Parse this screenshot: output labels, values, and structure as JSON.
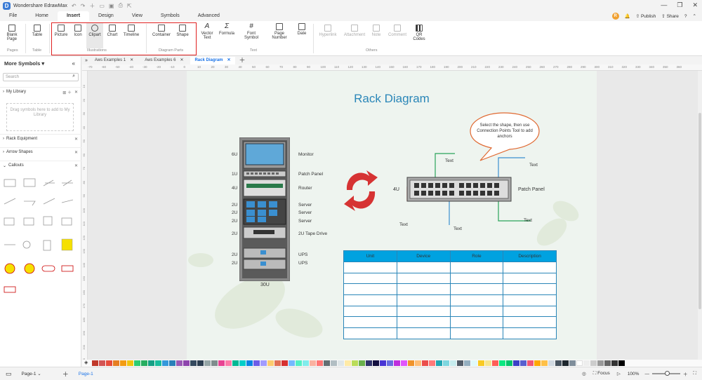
{
  "app": {
    "name": "Wondershare EdrawMax",
    "logo_letter": "D"
  },
  "user": {
    "initial": "R"
  },
  "window_controls": {
    "minimize": "—",
    "maximize": "❐",
    "close": "✕"
  },
  "menu": {
    "items": [
      "File",
      "Home",
      "Insert",
      "Design",
      "View",
      "Symbols",
      "Advanced"
    ],
    "active": "Insert",
    "publish": "Publish",
    "share": "Share",
    "help": "?"
  },
  "ribbon": {
    "blank_page": "Blank Page",
    "table": "Table",
    "picture": "Picture",
    "icon": "Icon",
    "clipart": "Clipart",
    "chart": "Chart",
    "timeline": "Timeline",
    "container": "Container",
    "shape": "Shape",
    "vector_text": "Vector Text",
    "formula": "Formula",
    "font_symbol": "Font Symbol",
    "page_number": "Page Number",
    "date": "Date",
    "hyperlink": "Hyperlink",
    "attachment": "Attachment",
    "note": "Note",
    "comment": "Comment",
    "qr_codes": "QR Codes",
    "groups": {
      "pages": "Pages",
      "table": "Table",
      "illustrations": "Illustrations",
      "diagram_parts": "Diagram Parts",
      "text": "Text",
      "others": "Others"
    }
  },
  "sidebar": {
    "title": "More Symbols",
    "search_placeholder": "Search",
    "my_library": "My Library",
    "drop_hint": "Drag symbols here to add to My Library",
    "sections": [
      "Rack Equipment",
      "Arrow Shapes",
      "Callouts"
    ]
  },
  "tabs": [
    "Aws Examples 1",
    "Aws Examples 6",
    "Rack Diagram"
  ],
  "active_tab": "Rack Diagram",
  "ruler": {
    "h_ticks": [
      "-70",
      "-60",
      "-50",
      "-40",
      "-30",
      "-20",
      "-10",
      "0",
      "10",
      "20",
      "30",
      "40",
      "50",
      "60",
      "70",
      "80",
      "90",
      "100",
      "110",
      "120",
      "130",
      "140",
      "150",
      "160",
      "170",
      "180",
      "190",
      "200",
      "210",
      "220",
      "230",
      "240",
      "250",
      "260",
      "270",
      "280",
      "290",
      "300",
      "310",
      "320",
      "330",
      "340",
      "350",
      "360"
    ],
    "v_ticks": [
      "10",
      "20",
      "30",
      "40",
      "50",
      "60",
      "70",
      "80",
      "90",
      "100",
      "110",
      "120",
      "130",
      "140",
      "150",
      "160",
      "170",
      "180",
      "190",
      "200",
      "210"
    ]
  },
  "diagram": {
    "title": "Rack Diagram",
    "rack_units_left": [
      "6U",
      "1U",
      "4U",
      "2U",
      "2U",
      "2U",
      "2U",
      "2U",
      "2U"
    ],
    "rack_labels": [
      "Monitor",
      "Patch Panel",
      "Router",
      "Server",
      "Server",
      "Server",
      "2U Tape Drive",
      "UPS",
      "UPS"
    ],
    "rack_total": "30U",
    "callout": "Select the shape, then use Connection Points Tool to add anchors",
    "patch_unit": "4U",
    "patch_label": "Patch Panel",
    "text_labels": [
      "Text",
      "Text",
      "Text",
      "Text",
      "Text"
    ],
    "table_headers": [
      "Unit",
      "Device",
      "Role",
      "Description"
    ]
  },
  "colors": {
    "accent": "#1a73e8",
    "table_header": "#00a2e0",
    "title": "#2a86b8",
    "sync_red": "#d63333",
    "callout_border": "#e06830",
    "wire_green": "#2aa35a",
    "wire_blue": "#3a8fd0",
    "wire_red": "#e03030",
    "palette": [
      "#c0392b",
      "#d35454",
      "#e74c3c",
      "#e67e22",
      "#f39c12",
      "#f1c40f",
      "#2ecc71",
      "#27ae60",
      "#16a085",
      "#1abc9c",
      "#3498db",
      "#2980b9",
      "#9b59b6",
      "#8e44ad",
      "#34495e",
      "#2c3e50",
      "#95a5a6",
      "#7f8c8d",
      "#e84393",
      "#fd79a8",
      "#00b894",
      "#00cec9",
      "#0984e3",
      "#6c5ce7",
      "#a29bfe",
      "#fdcb6e",
      "#e17055",
      "#d63031",
      "#74b9ff",
      "#55efc4",
      "#81ecec",
      "#fab1a0",
      "#ff7675",
      "#636e72",
      "#b2bec3",
      "#dfe6e9",
      "#ffeaa7",
      "#badc58",
      "#6ab04c",
      "#30336b",
      "#130f40",
      "#4834d4",
      "#686de0",
      "#be2edd",
      "#e056fd",
      "#f0932b",
      "#ffbe76",
      "#eb4d4b",
      "#ff7979",
      "#22a6b3",
      "#7ed6df",
      "#c7ecee",
      "#535c68",
      "#95afc0",
      "#dff9fb",
      "#f9ca24",
      "#f6e58d",
      "#ff5e57",
      "#0be881",
      "#05c46b",
      "#3c40c6",
      "#575fcf",
      "#ef5777",
      "#ffa801",
      "#ffc048",
      "#d2dae2",
      "#485460",
      "#1e272e",
      "#808e9b",
      "#ffffff",
      "#eeeeee",
      "#cccccc",
      "#999999",
      "#666666",
      "#333333",
      "#000000"
    ]
  },
  "status": {
    "page_tab": "Page-1",
    "page_tab2": "Page-1",
    "focus": "Focus",
    "zoom": "100%"
  }
}
